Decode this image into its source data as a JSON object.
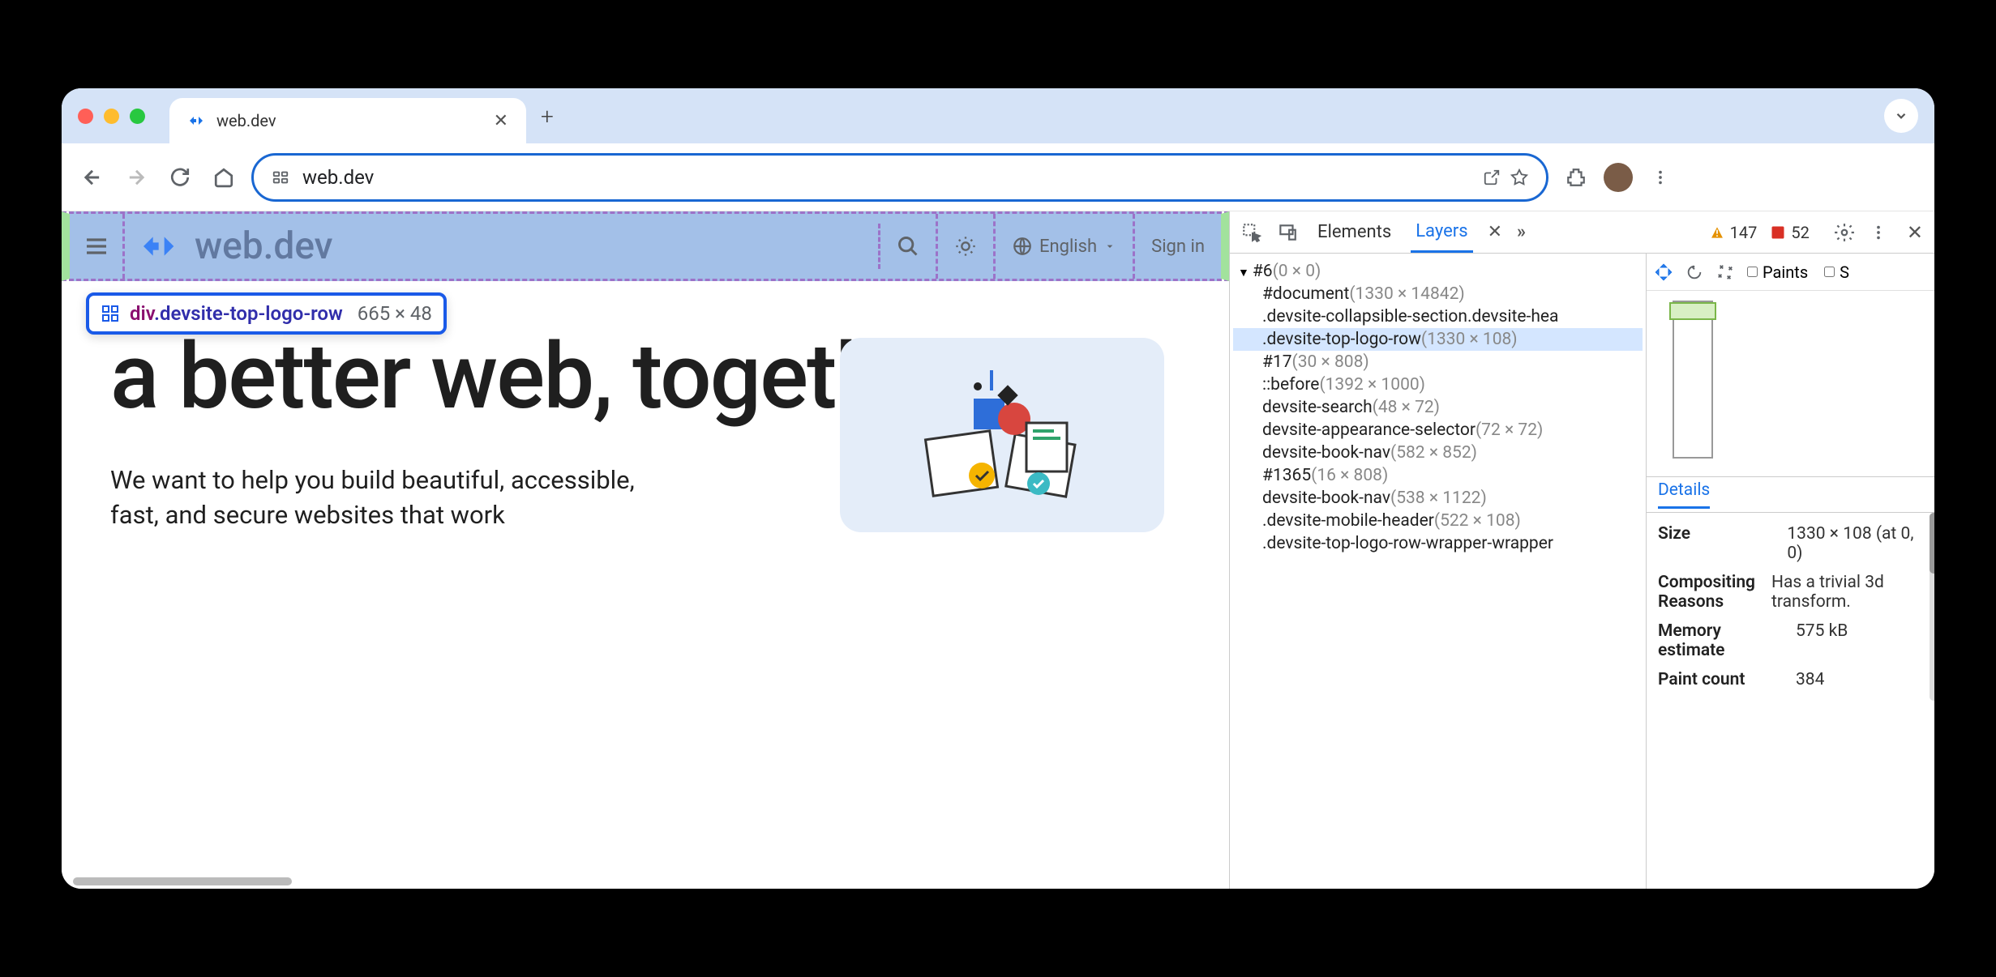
{
  "browser": {
    "tab_title": "web.dev",
    "omni_text": "web.dev"
  },
  "page": {
    "header": {
      "logo_text": "web.dev",
      "language": "English",
      "signin": "Sign in"
    },
    "inspect_tip": {
      "tag": "div",
      "cls": ".devsite-top-logo-row",
      "dim": "665 × 48"
    },
    "hero": {
      "title": "a better web, together",
      "body": "We want to help you build beautiful, accessible, fast, and secure websites that work"
    }
  },
  "devtools": {
    "tabs": {
      "elements": "Elements",
      "layers": "Layers"
    },
    "counts": {
      "warn": "147",
      "err": "52"
    },
    "tree": [
      {
        "name": "#6",
        "size": "(0 × 0)",
        "arrow": true,
        "ind": 0
      },
      {
        "name": "#document",
        "size": "(1330 × 14842)",
        "ind": 1
      },
      {
        "name": ".devsite-collapsible-section.devsite-hea",
        "size": "",
        "ind": 1
      },
      {
        "name": ".devsite-top-logo-row",
        "size": "(1330 × 108)",
        "ind": 1,
        "sel": true
      },
      {
        "name": "#17",
        "size": "(30 × 808)",
        "ind": 1
      },
      {
        "name": "::before",
        "size": "(1392 × 1000)",
        "ind": 1
      },
      {
        "name": "devsite-search",
        "size": "(48 × 72)",
        "ind": 1
      },
      {
        "name": "devsite-appearance-selector",
        "size": "(72 × 72)",
        "ind": 1
      },
      {
        "name": "devsite-book-nav",
        "size": "(582 × 852)",
        "ind": 1
      },
      {
        "name": "#1365",
        "size": "(16 × 808)",
        "ind": 1
      },
      {
        "name": "devsite-book-nav",
        "size": "(538 × 1122)",
        "ind": 1
      },
      {
        "name": ".devsite-mobile-header",
        "size": "(522 × 108)",
        "ind": 1
      },
      {
        "name": ".devsite-top-logo-row-wrapper-wrapper",
        "size": "",
        "ind": 1
      }
    ],
    "side": {
      "paints_label": "Paints",
      "details_tab": "Details",
      "details": [
        {
          "k": "Size",
          "v": "1330 × 108 (at 0, 0)"
        },
        {
          "k": "Compositing Reasons",
          "v": "Has a trivial 3d transform."
        },
        {
          "k": "Memory estimate",
          "v": "575 kB"
        },
        {
          "k": "Paint count",
          "v": "384"
        }
      ]
    }
  }
}
